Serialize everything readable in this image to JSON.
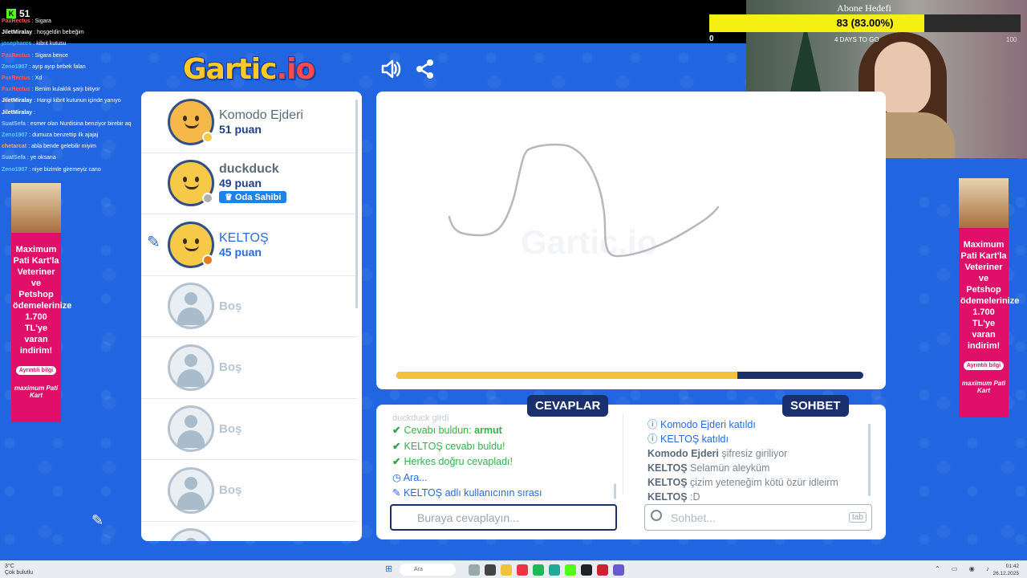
{
  "stream": {
    "kick_viewers": "51",
    "chat": [
      {
        "user": "PaxRectus",
        "user_color": "#ff5a5a",
        "msg": "Sigara"
      },
      {
        "user": "JiletMiralay",
        "user_color": "#ffffff",
        "msg": "hoşgeldin bebeğim"
      },
      {
        "user": "josephanrs",
        "user_color": "#36c5f0",
        "msg": "kibrit kutusu"
      },
      {
        "user": "PaxRectus",
        "user_color": "#ff5a5a",
        "msg": "Sigara bence"
      },
      {
        "user": "Zeno1907",
        "user_color": "#6cf",
        "msg": "ayıp ayıp bebek falan"
      },
      {
        "user": "PaxRectus",
        "user_color": "#ff5a5a",
        "msg": "Xd"
      },
      {
        "user": "PaxRectus",
        "user_color": "#ff5a5a",
        "msg": "Benim kulaklık şarjı bitiyor"
      },
      {
        "user": "JiletMiralay",
        "user_color": "#ffffff",
        "msg": "Hangi kibrit kutunun içinde yanıyo"
      },
      {
        "user": "JiletMiralay",
        "user_color": "#ffffff",
        "msg": ""
      },
      {
        "user": "SuatSefa",
        "user_color": "#9ecbff",
        "msg": "esmer olan Nurdisina benziyor birebir aq"
      },
      {
        "user": "Zeno1907",
        "user_color": "#6cf",
        "msg": "dumuza benzettip ilk ajajaj"
      },
      {
        "user": "chetarcat",
        "user_color": "#ffae42",
        "msg": "abla bende gelebilir miyim"
      },
      {
        "user": "SuatSefa",
        "user_color": "#9ecbff",
        "msg": "ye oksana"
      },
      {
        "user": "Zeno1907",
        "user_color": "#6cf",
        "msg": "niye bizimle giremeyiz cano"
      }
    ],
    "goal": {
      "title": "Abone Hedefi",
      "progress_text": "83 (83.00%)",
      "fraction": 0.83,
      "min": "0",
      "max": "100",
      "days": "4 DAYS TO GO"
    }
  },
  "game": {
    "logo_main": "Gartic",
    "logo_suffix": ".io",
    "players": [
      {
        "name": "Komodo Ejderi",
        "score": "51 puan",
        "badge_color": "#f7c948",
        "hair": true
      },
      {
        "name": "duckduck",
        "score": "49 puan",
        "badge_color": "#b0b0b0",
        "owner_label": "Oda Sahibi"
      },
      {
        "name": "KELTOŞ",
        "score": "45 puan",
        "badge_color": "#e07b24",
        "drawing": true
      }
    ],
    "empty_slot_label": "Boş",
    "timer_fraction": 0.73,
    "watermark": "Gartic.io",
    "tabs": {
      "answers": "CEVAPLAR",
      "chat": "SOHBET"
    },
    "answers_log": {
      "faded": "duckduck girdi",
      "found_prefix": "Cevabı buldun:",
      "found_word": "armut",
      "keltos_found": "KELTOŞ cevabı buldu!",
      "all_found": "Herkes doğru cevapladı!",
      "waiting": "Ara...",
      "turn": "KELTOŞ adlı kullanıcının sırası"
    },
    "answer_placeholder": "Buraya cevaplayın...",
    "chat_log": {
      "join1": "Komodo Ejderi katıldı",
      "join2": "KELTOŞ katıldı",
      "line1_name": "Komodo Ejderi",
      "line1_msg": "şifresiz giriliyor",
      "line2_name": "KELTOŞ",
      "line2_msg": "Selamün aleyküm",
      "line3_name": "KELTOŞ",
      "line3_msg": "çizim yeteneğim kötü özür idleirm",
      "line4_name": "KELTOŞ",
      "line4_msg": ":D"
    },
    "chat_placeholder": "Sohbet...",
    "tab_key": "tab"
  },
  "ad": {
    "text": "Maximum Pati Kart'la Veteriner ve Petshop ödemelerinize 1.700 TL'ye varan indirim!",
    "more": "Ayrıntılı bilgi",
    "brand": "maximum Pati Kart"
  },
  "taskbar": {
    "weather_temp": "3°C",
    "weather_desc": "Çok bulutlu",
    "search": "Ara",
    "time": "01:42",
    "date": "26.12.2025"
  }
}
